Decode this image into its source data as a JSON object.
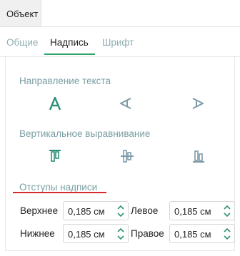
{
  "header": {
    "tab_label": "Объект"
  },
  "subtabs": [
    {
      "label": "Общие",
      "active": false
    },
    {
      "label": "Надпись",
      "active": true
    },
    {
      "label": "Шрифт",
      "active": false
    }
  ],
  "text_direction": {
    "label": "Направление текста",
    "options": [
      "horizontal",
      "rotate-90",
      "rotate-270"
    ]
  },
  "vertical_align": {
    "label": "Вертикальное выравнивание",
    "options": [
      "top",
      "center",
      "bottom"
    ]
  },
  "margins": {
    "label": "Отступы надписи",
    "top": {
      "label": "Верхнее",
      "value": "0,185 см"
    },
    "left": {
      "label": "Левое",
      "value": "0,185 см"
    },
    "bottom": {
      "label": "Нижнее",
      "value": "0,185 см"
    },
    "right": {
      "label": "Правое",
      "value": "0,185 см"
    }
  },
  "colors": {
    "accent": "#2ea36a",
    "muted_label": "#7a9ea3",
    "icon_active": "#2e8f78",
    "icon_inactive": "#7f9aa8",
    "highlight_underline": "#d42b2b"
  }
}
